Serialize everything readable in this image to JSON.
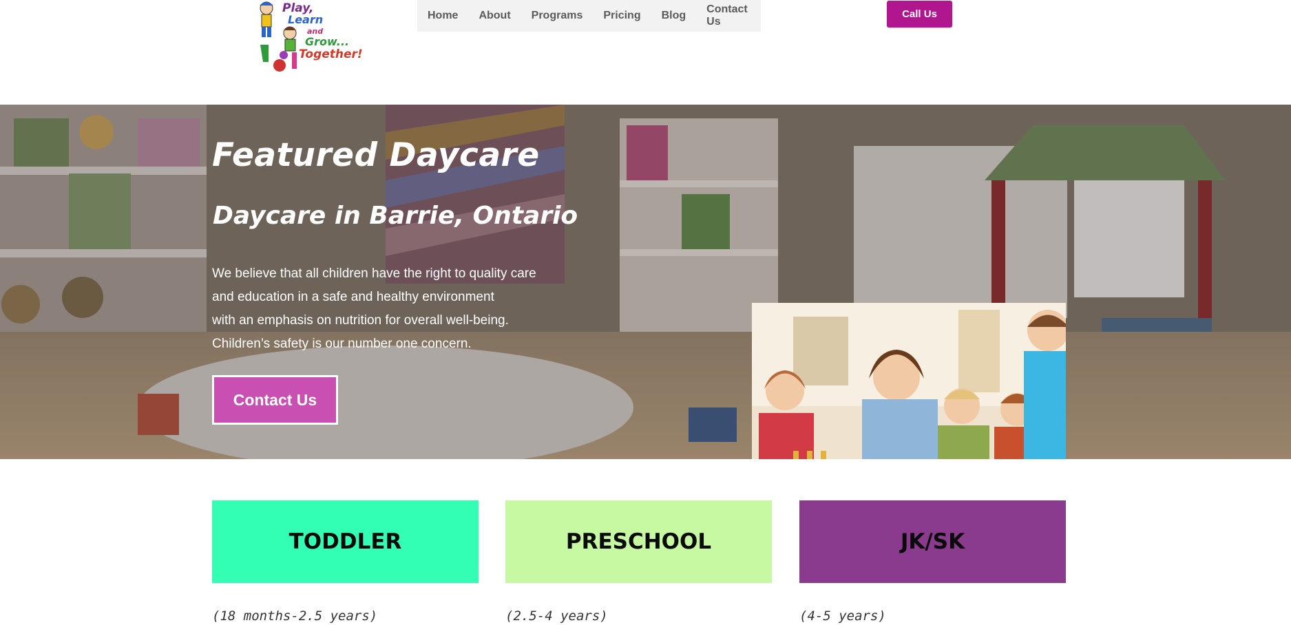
{
  "logo": {
    "lines": [
      "Play,",
      "Learn",
      "and",
      "Grow...",
      "Together!"
    ]
  },
  "nav": {
    "items": [
      "Home",
      "About",
      "Programs",
      "Pricing",
      "Blog",
      "Contact Us"
    ]
  },
  "header": {
    "call_label": "Call Us"
  },
  "hero": {
    "title": "Featured Daycare",
    "subtitle": "Daycare in Barrie, Ontario",
    "description_lines": [
      "We believe that all children have the right to quality care",
      "and education in a safe and healthy environment",
      "with an emphasis on nutrition for overall well-being.",
      "Children’s safety is our number one concern."
    ],
    "contact_label": "Contact Us"
  },
  "programs": [
    {
      "name": "TODDLER",
      "ages": "(18 months-2.5 years)"
    },
    {
      "name": "PRESCHOOL",
      "ages": "(2.5-4 years)"
    },
    {
      "name": "JK/SK",
      "ages": "(4-5 years)"
    }
  ],
  "colors": {
    "brand_magenta": "#b0168e",
    "contact_button": "#c94fb3",
    "toddler": "#33ffb4",
    "preschool": "#c7f9a2",
    "jksk": "#8a3b8d"
  }
}
